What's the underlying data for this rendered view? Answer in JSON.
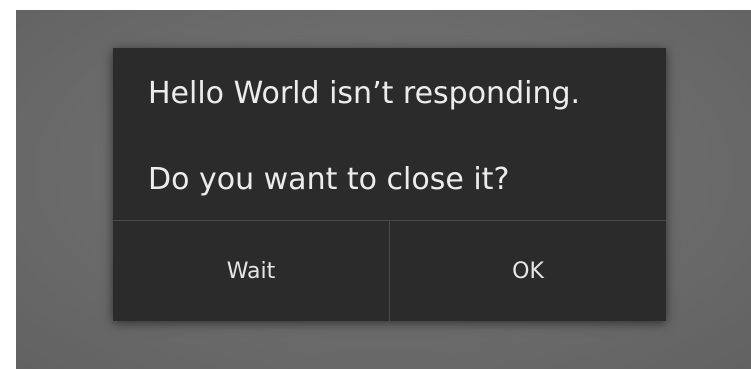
{
  "dialog": {
    "message_line1": "Hello World isn’t responding.",
    "message_line2": "Do you want to close it?",
    "buttons": {
      "wait_label": "Wait",
      "ok_label": "OK"
    }
  }
}
